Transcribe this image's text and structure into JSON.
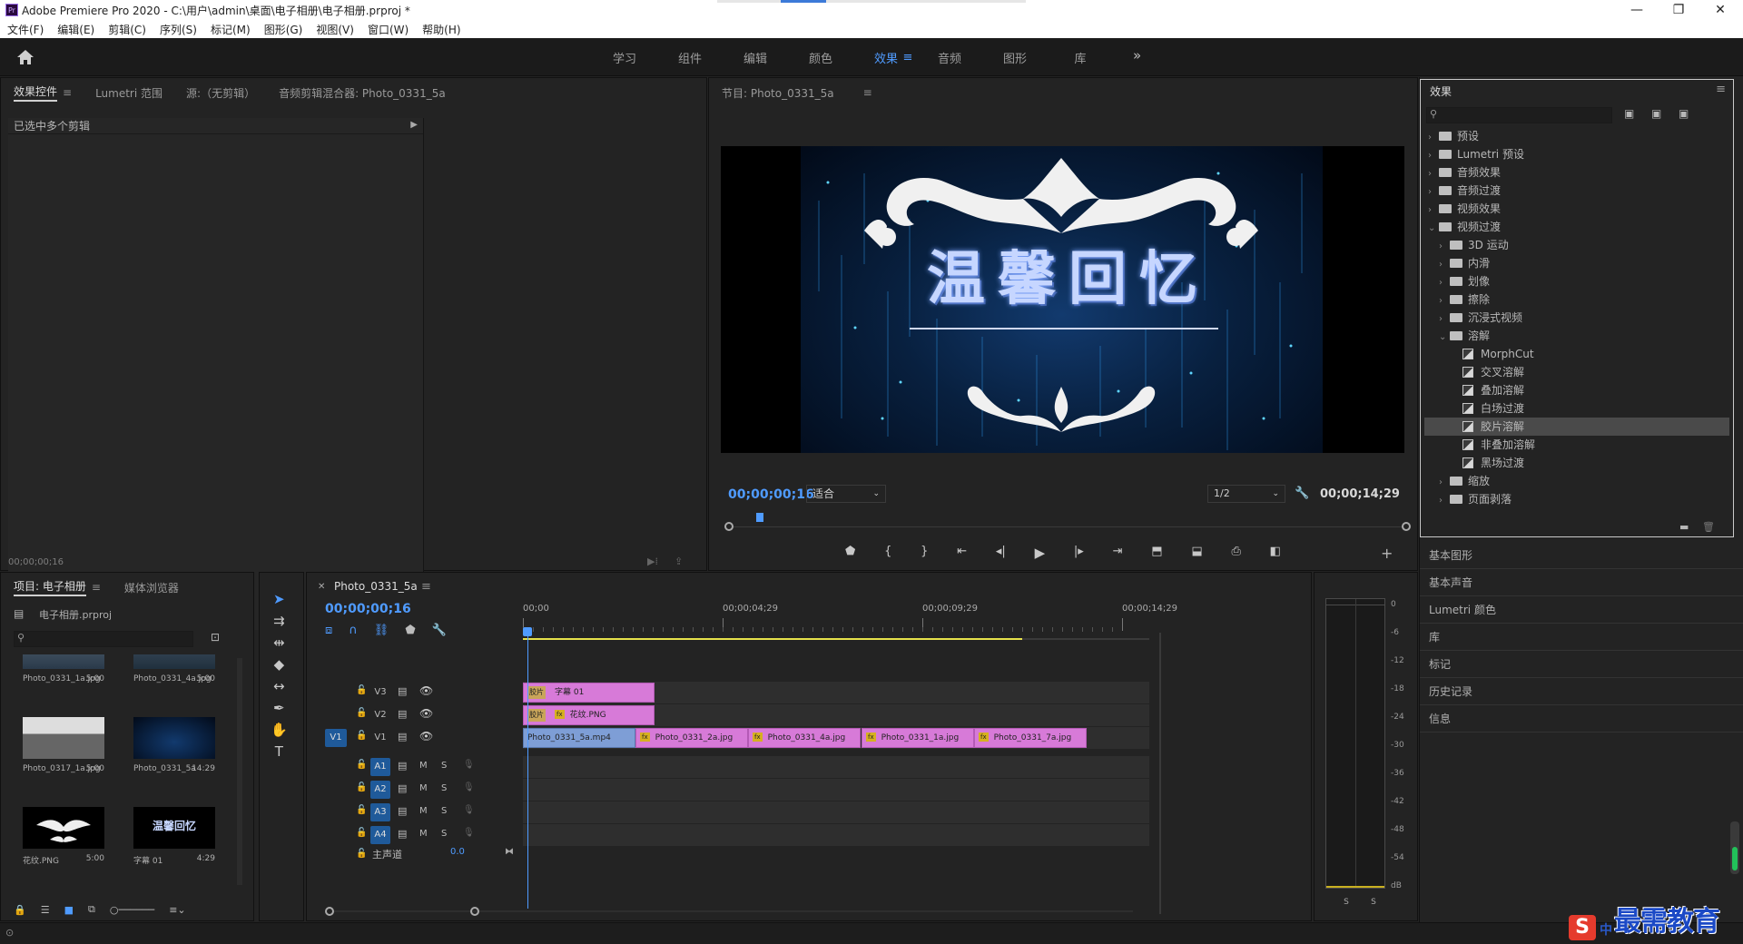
{
  "window": {
    "title": "Adobe Premiere Pro 2020 - C:\\用户\\admin\\桌面\\电子相册\\电子相册.prproj *",
    "app_icon": "Pr"
  },
  "menu": [
    "文件(F)",
    "编辑(E)",
    "剪辑(C)",
    "序列(S)",
    "标记(M)",
    "图形(G)",
    "视图(V)",
    "窗口(W)",
    "帮助(H)"
  ],
  "workspaces": {
    "tabs": [
      "学习",
      "组件",
      "编辑",
      "颜色",
      "效果",
      "音频",
      "图形",
      "库"
    ],
    "active": "效果",
    "more": "»"
  },
  "source_panel": {
    "tabs": [
      "效果控件",
      "Lumetri 范围",
      "源:（无剪辑）",
      "音频剪辑混合器: Photo_0331_5a"
    ],
    "active_tab": "效果控件",
    "message": "已选中多个剪辑",
    "timecode": "00;00;00;16"
  },
  "program": {
    "title": "节目: Photo_0331_5a",
    "timecode": "00;00;00;16",
    "fit": "适合",
    "quality": "1/2",
    "duration": "00;00;14;29",
    "overlay_text": "温馨回忆",
    "playhead": 0.04
  },
  "effects": {
    "title": "效果",
    "tree": [
      {
        "label": "预设",
        "depth": 0,
        "open": false,
        "type": "folder"
      },
      {
        "label": "Lumetri 预设",
        "depth": 0,
        "open": false,
        "type": "folder"
      },
      {
        "label": "音频效果",
        "depth": 0,
        "open": false,
        "type": "folder"
      },
      {
        "label": "音频过渡",
        "depth": 0,
        "open": false,
        "type": "folder"
      },
      {
        "label": "视频效果",
        "depth": 0,
        "open": false,
        "type": "folder"
      },
      {
        "label": "视频过渡",
        "depth": 0,
        "open": true,
        "type": "folder"
      },
      {
        "label": "3D 运动",
        "depth": 1,
        "open": false,
        "type": "folder"
      },
      {
        "label": "内滑",
        "depth": 1,
        "open": false,
        "type": "folder"
      },
      {
        "label": "划像",
        "depth": 1,
        "open": false,
        "type": "folder"
      },
      {
        "label": "擦除",
        "depth": 1,
        "open": false,
        "type": "folder"
      },
      {
        "label": "沉浸式视频",
        "depth": 1,
        "open": false,
        "type": "folder"
      },
      {
        "label": "溶解",
        "depth": 1,
        "open": true,
        "type": "folder"
      },
      {
        "label": "MorphCut",
        "depth": 2,
        "type": "effect"
      },
      {
        "label": "交叉溶解",
        "depth": 2,
        "type": "effect"
      },
      {
        "label": "叠加溶解",
        "depth": 2,
        "type": "effect"
      },
      {
        "label": "白场过渡",
        "depth": 2,
        "type": "effect"
      },
      {
        "label": "胶片溶解",
        "depth": 2,
        "type": "effect",
        "selected": true
      },
      {
        "label": "非叠加溶解",
        "depth": 2,
        "type": "effect"
      },
      {
        "label": "黑场过渡",
        "depth": 2,
        "type": "effect"
      },
      {
        "label": "缩放",
        "depth": 1,
        "open": false,
        "type": "folder"
      },
      {
        "label": "页面剥落",
        "depth": 1,
        "open": false,
        "type": "folder"
      }
    ]
  },
  "side_panels": [
    "基本图形",
    "基本声音",
    "Lumetri 颜色",
    "库",
    "标记",
    "历史记录",
    "信息"
  ],
  "project": {
    "tabs": [
      "项目: 电子相册",
      "媒体浏览器"
    ],
    "file": "电子相册.prproj",
    "items": [
      {
        "name": "Photo_0331_1a.jpg",
        "dur": "5:00"
      },
      {
        "name": "Photo_0331_4a.jpg",
        "dur": "5:00"
      },
      {
        "name": "Photo_0317_1a.jpg",
        "dur": "5:00"
      },
      {
        "name": "Photo_0331_5a",
        "dur": "14:29"
      },
      {
        "name": "花纹.PNG",
        "dur": "5:00"
      },
      {
        "name": "字幕 01",
        "dur": "4:29"
      }
    ],
    "thumb_text": "温馨回忆"
  },
  "timeline": {
    "tab": "Photo_0331_5a",
    "timecode": "00;00;00;16",
    "ruler": [
      "00;00",
      "00;00;04;29",
      "00;00;09;29",
      "00;00;14;29"
    ],
    "tracks": {
      "video": [
        "V3",
        "V2",
        "V1"
      ],
      "audio": [
        "A1",
        "A2",
        "A3",
        "A4"
      ],
      "source_patch": "V1"
    },
    "master": {
      "label": "主声道",
      "value": "0.0"
    },
    "mute": "M",
    "solo": "S",
    "clips": {
      "v3": {
        "name": "字幕 01",
        "tag": "胶片"
      },
      "v2": {
        "name": "花纹.PNG",
        "tag": "胶片"
      },
      "v1": [
        {
          "name": "Photo_0331_5a.mp4",
          "start": 0,
          "end": 0.179
        },
        {
          "name": "Photo_0331_2a.jpg",
          "start": 0.18,
          "end": 0.359
        },
        {
          "name": "Photo_0331_4a.jpg",
          "start": 0.36,
          "end": 0.539
        },
        {
          "name": "Photo_0331_1a.jpg",
          "start": 0.54,
          "end": 0.719
        },
        {
          "name": "Photo_0331_7a.jpg",
          "start": 0.72,
          "end": 0.899
        }
      ],
      "fx": "fx"
    }
  },
  "meter": {
    "labels": [
      "0",
      "-6",
      "-12",
      "-18",
      "-24",
      "-30",
      "-36",
      "-42",
      "-48",
      "-54",
      "dB"
    ],
    "solo": [
      "S",
      "S"
    ]
  },
  "watermark": {
    "text": "最需教育",
    "logo": "S",
    "sub": "中"
  },
  "colors": {
    "accent": "#4f9bff",
    "clip_pink": "#d77ad8",
    "clip_blue": "#7e9ed6",
    "work_area": "#e6e14b"
  }
}
